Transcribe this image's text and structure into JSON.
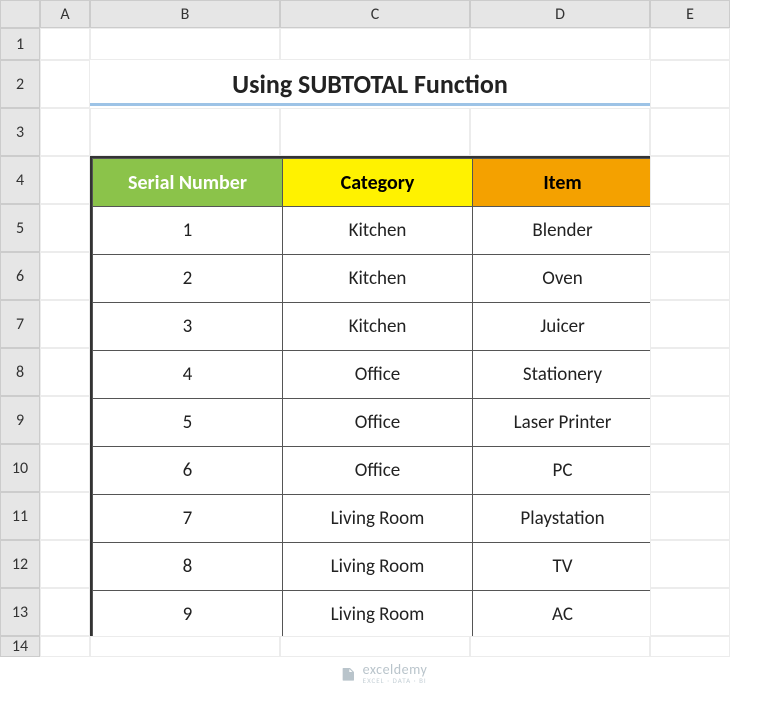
{
  "columns": [
    "A",
    "B",
    "C",
    "D",
    "E"
  ],
  "rows": [
    "1",
    "2",
    "3",
    "4",
    "5",
    "6",
    "7",
    "8",
    "9",
    "10",
    "11",
    "12",
    "13",
    "14"
  ],
  "title": "Using SUBTOTAL Function",
  "table": {
    "headers": {
      "serial": "Serial Number",
      "category": "Category",
      "item": "Item"
    },
    "rows": [
      {
        "serial": "1",
        "category": "Kitchen",
        "item": "Blender"
      },
      {
        "serial": "2",
        "category": "Kitchen",
        "item": "Oven"
      },
      {
        "serial": "3",
        "category": "Kitchen",
        "item": "Juicer"
      },
      {
        "serial": "4",
        "category": "Office",
        "item": "Stationery"
      },
      {
        "serial": "5",
        "category": "Office",
        "item": "Laser Printer"
      },
      {
        "serial": "6",
        "category": "Office",
        "item": "PC"
      },
      {
        "serial": "7",
        "category": "Living Room",
        "item": "Playstation"
      },
      {
        "serial": "8",
        "category": "Living Room",
        "item": "TV"
      },
      {
        "serial": "9",
        "category": "Living Room",
        "item": "AC"
      }
    ]
  },
  "watermark": {
    "brand": "exceldemy",
    "tagline": "EXCEL · DATA · BI"
  }
}
